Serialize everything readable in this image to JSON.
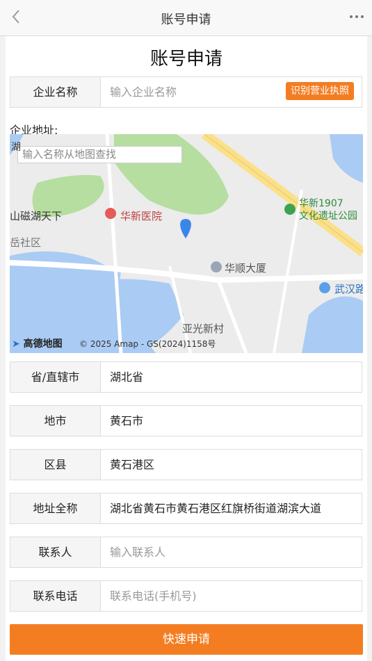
{
  "topbar": {
    "title": "账号申请",
    "back_icon": "chevron-left-icon",
    "more_icon": "more-dots-icon"
  },
  "form": {
    "heading": "账号申请",
    "company_name": {
      "label": "企业名称",
      "placeholder": "输入企业名称",
      "ocr_button": "识别营业执照"
    },
    "address_label": "企业地址:",
    "province": {
      "label": "省/直辖市",
      "value": "湖北省"
    },
    "city": {
      "label": "地市",
      "value": "黄石市"
    },
    "district": {
      "label": "区县",
      "value": "黄石港区"
    },
    "full_address": {
      "label": "地址全称",
      "value": "湖北省黄石市黄石港区红旗桥街道湖滨大道"
    },
    "contact": {
      "label": "联系人",
      "placeholder": "输入联系人"
    },
    "phone": {
      "label": "联系电话",
      "placeholder": "联系电话(手机号)"
    },
    "submit": "快速申请"
  },
  "map": {
    "search_placeholder": "输入名称从地图查找",
    "labels": {
      "left_top": "湖",
      "cishan": "山磁湖天下",
      "hospital": "华新医院",
      "park_line1": "华新1907",
      "park_line2": "文化遗址公园",
      "shequ": "岳社区",
      "huashun": "华顺大厦",
      "wuhan": "武汉路",
      "yaguang": "亚光新村"
    },
    "logo": "高德地图",
    "copyright": "© 2025 Amap - GS(2024)1158号",
    "colors": {
      "water": "#aacbf3",
      "green": "#b5dea0",
      "road": "#fbe08a",
      "pin": "#3a86e8"
    }
  }
}
